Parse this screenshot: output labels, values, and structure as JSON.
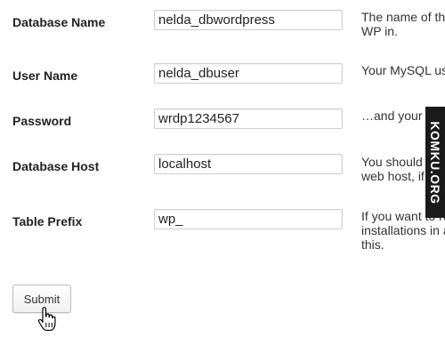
{
  "form": {
    "rows": [
      {
        "label": "Database Name",
        "value": "nelda_dbwordpress",
        "description_lines": [
          "The name of the",
          "WP in."
        ]
      },
      {
        "label": "User Name",
        "value": "nelda_dbuser",
        "description_lines": [
          "Your MySQL us"
        ]
      },
      {
        "label": "Password",
        "value": "wrdp1234567",
        "description_lines": [
          "…and your My"
        ]
      },
      {
        "label": "Database Host",
        "value": "localhost",
        "description_lines": [
          "You should",
          "web host, if"
        ]
      },
      {
        "label": "Table Prefix",
        "value": "wp_",
        "description_lines": [
          "If you want to ru",
          "installations in a",
          "this."
        ]
      }
    ],
    "submit_label": "Submit"
  },
  "watermark": {
    "text": "KOMKU.ORG"
  },
  "icons": {
    "cursor": "hand-pointer-icon"
  }
}
